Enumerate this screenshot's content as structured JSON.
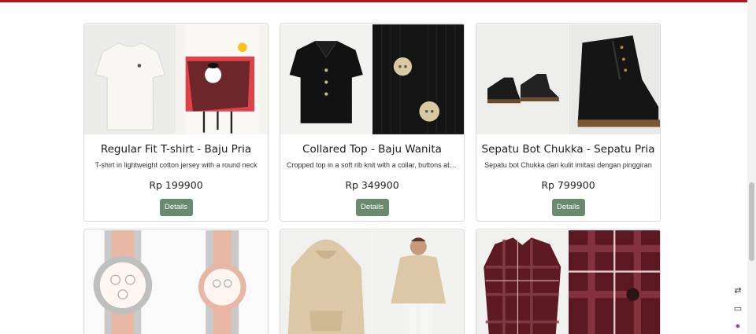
{
  "products": [
    {
      "title": "Regular Fit T-shirt - Baju Pria",
      "description": "T-shirt in lightweight cotton jersey with a round neck",
      "price": "Rp 199900",
      "button_label": "Details",
      "image_left": "tshirt-white-icon",
      "image_right": "tshirt-graphic-icon"
    },
    {
      "title": "Collared Top - Baju Wanita",
      "description": "Cropped top in a soft rib knit with a collar, buttons at the front",
      "price": "Rp 349900",
      "button_label": "Details",
      "image_left": "collared-top-icon",
      "image_right": "knit-buttons-icon"
    },
    {
      "title": "Sepatu Bot Chukka - Sepatu Pria",
      "description": "Sepatu bot Chukka dari kulit imitasi dengan pinggiran",
      "price": "Rp 799900",
      "button_label": "Details",
      "image_left": "chukka-boots-icon",
      "image_right": "boot-closeup-icon"
    },
    {
      "image_left": "watch-silver-icon",
      "image_right": "watch-rosegold-icon"
    },
    {
      "image_left": "hoodie-beige-icon",
      "image_right": "hoodie-model-icon"
    },
    {
      "image_left": "flannel-shirt-icon",
      "image_right": "flannel-closeup-icon"
    }
  ],
  "colors": {
    "top_bar": "#b3161d",
    "button_bg": "#6a8a6e",
    "card_border": "#d9d9d9"
  },
  "side_tools": [
    "translate-icon",
    "book-icon",
    "brain-icon"
  ]
}
